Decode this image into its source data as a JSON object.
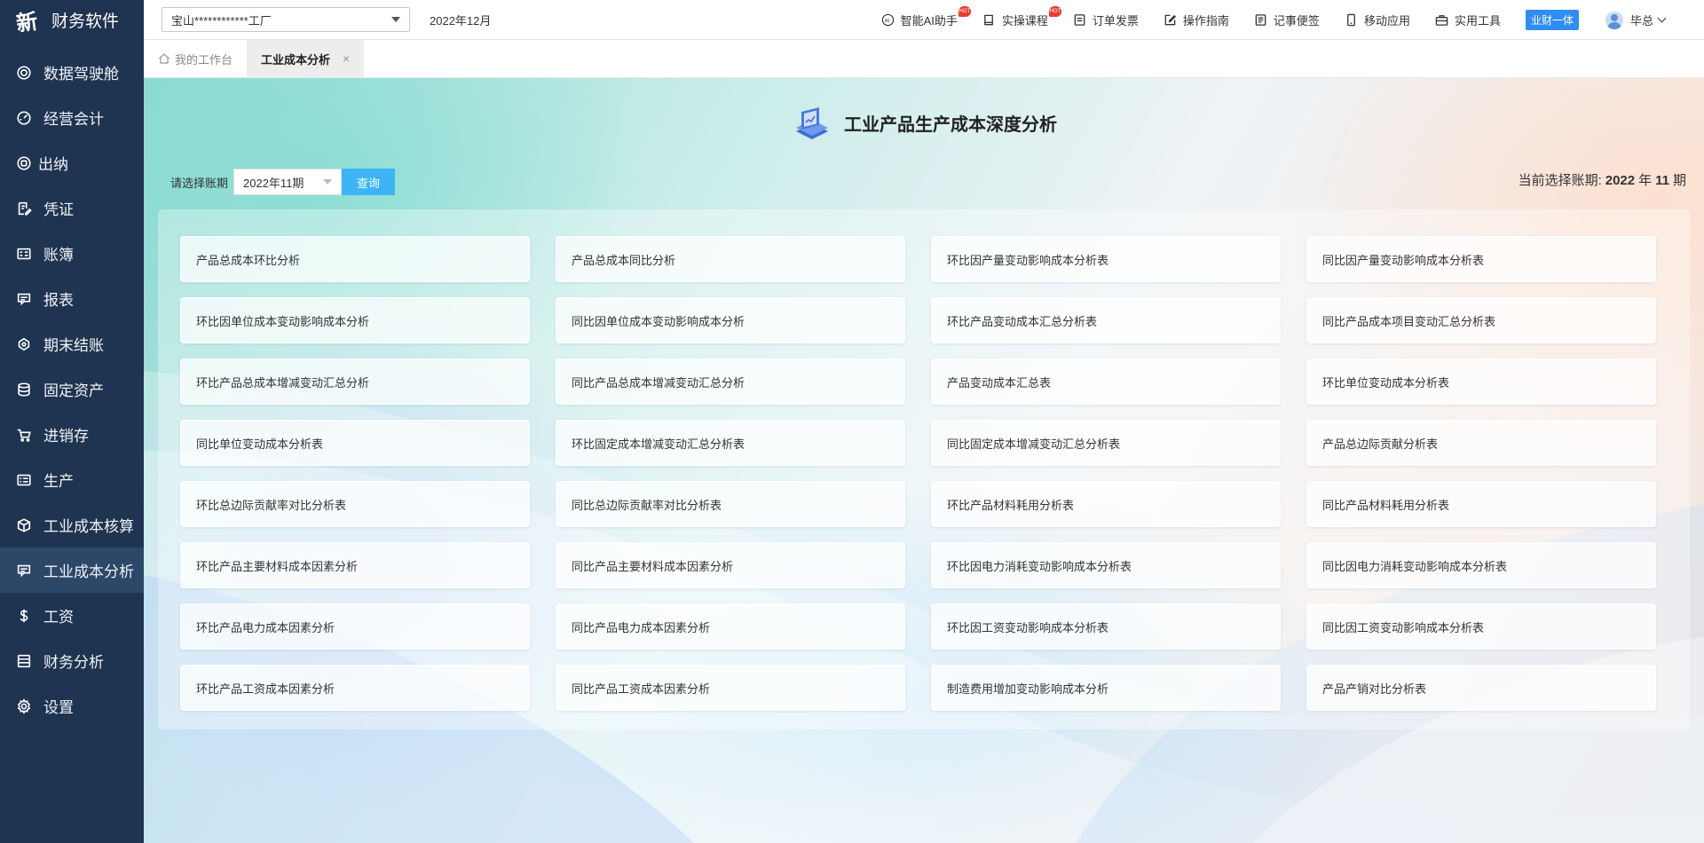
{
  "app": {
    "logo_mark": "新",
    "title": "财务软件"
  },
  "sidebar": {
    "items": [
      {
        "label": "数据驾驶舱",
        "icon": "dashboard-icon"
      },
      {
        "label": "经营会计",
        "icon": "gauge-icon"
      },
      {
        "label": "出纳",
        "icon": "cashier-icon"
      },
      {
        "label": "凭证",
        "icon": "voucher-icon"
      },
      {
        "label": "账簿",
        "icon": "ledger-icon"
      },
      {
        "label": "报表",
        "icon": "report-icon"
      },
      {
        "label": "期末结账",
        "icon": "closing-icon"
      },
      {
        "label": "固定资产",
        "icon": "database-icon"
      },
      {
        "label": "进销存",
        "icon": "cart-icon"
      },
      {
        "label": "生产",
        "icon": "production-icon"
      },
      {
        "label": "工业成本核算",
        "icon": "cube-icon"
      },
      {
        "label": "工业成本分析",
        "icon": "analysis-icon",
        "active": true
      },
      {
        "label": "工资",
        "icon": "dollar-icon"
      },
      {
        "label": "财务分析",
        "icon": "finance-analysis-icon"
      },
      {
        "label": "设置",
        "icon": "gear-icon"
      }
    ]
  },
  "topbar": {
    "company": "宝山************工厂",
    "period": "2022年12月",
    "buttons": [
      {
        "label": "智能AI助手",
        "hot": "HOT"
      },
      {
        "label": "实操课程",
        "hot": "HOT"
      },
      {
        "label": "订单发票"
      },
      {
        "label": "操作指南"
      },
      {
        "label": "记事便签"
      },
      {
        "label": "移动应用"
      },
      {
        "label": "实用工具"
      }
    ],
    "badge": "业财一体",
    "user": "毕总"
  },
  "tabs": [
    {
      "label": "我的工作台"
    },
    {
      "label": "工业成本分析",
      "close": "×"
    }
  ],
  "main": {
    "title": "工业产品生产成本深度分析",
    "filter_label": "请选择账期",
    "period_value": "2022年11期",
    "query_label": "查询",
    "current_period": {
      "prefix": "当前选择账期:",
      "year": "2022",
      "year_unit": "年",
      "period": "11",
      "period_unit": "期"
    },
    "cards": [
      "产品总成本环比分析",
      "产品总成本同比分析",
      "环比因产量变动影响成本分析表",
      "同比因产量变动影响成本分析表",
      "环比因单位成本变动影响成本分析",
      "同比因单位成本变动影响成本分析",
      "环比产品变动成本汇总分析表",
      "同比产品成本项目变动汇总分析表",
      "环比产品总成本增减变动汇总分析",
      "同比产品总成本增减变动汇总分析",
      "产品变动成本汇总表",
      "环比单位变动成本分析表",
      "同比单位变动成本分析表",
      "环比固定成本增减变动汇总分析表",
      "同比固定成本增减变动汇总分析表",
      "产品总边际贡献分析表",
      "环比总边际贡献率对比分析表",
      "同比总边际贡献率对比分析表",
      "环比产品材料耗用分析表",
      "同比产品材料耗用分析表",
      "环比产品主要材料成本因素分析",
      "同比产品主要材料成本因素分析",
      "环比因电力消耗变动影响成本分析表",
      "同比因电力消耗变动影响成本分析表",
      "环比产品电力成本因素分析",
      "同比产品电力成本因素分析",
      "环比因工资变动影响成本分析表",
      "同比因工资变动影响成本分析表",
      "环比产品工资成本因素分析",
      "同比产品工资成本因素分析",
      "制造费用增加变动影响成本分析",
      "产品产销对比分析表"
    ]
  }
}
